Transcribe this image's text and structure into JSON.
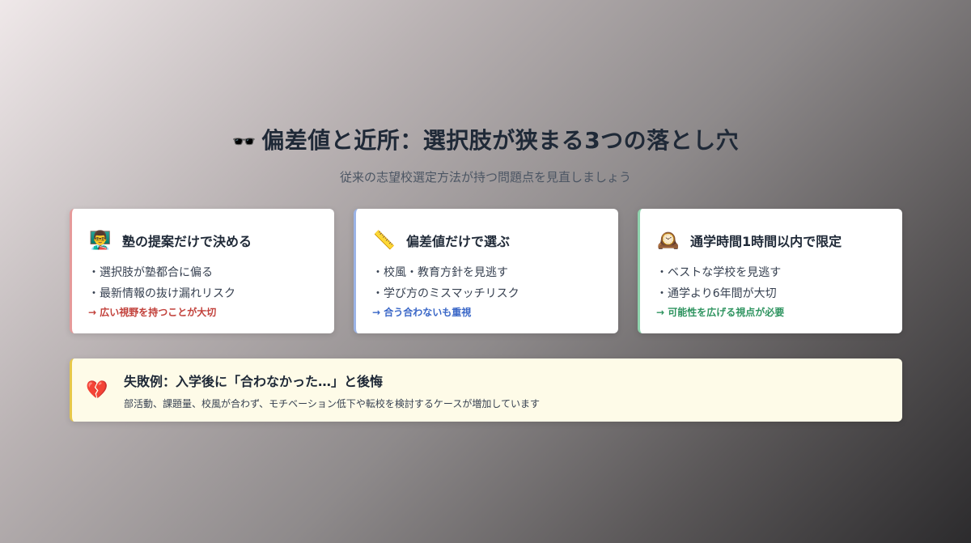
{
  "header": {
    "icon": "🕶️",
    "title": "偏差値と近所：選択肢が狭まる3つの落とし穴",
    "subtitle": "従来の志望校選定方法が持つ問題点を見直しましょう"
  },
  "cards": [
    {
      "icon": "👨‍🏫",
      "title": "塾の提案だけで決める",
      "points": [
        "・選択肢が塾都合に偏る",
        "・最新情報の抜け漏れリスク"
      ],
      "note": "→ 広い視野を持つことが大切",
      "accent": "#c2413b"
    },
    {
      "icon": "📏",
      "title": "偏差値だけで選ぶ",
      "points": [
        "・校風・教育方針を見逃す",
        "・学び方のミスマッチリスク"
      ],
      "note": "→ 合う合わないも重視",
      "accent": "#3a67c7"
    },
    {
      "icon": "🕰️",
      "title": "通学時間1時間以内で限定",
      "points": [
        "・ベストな学校を見逃す",
        "・通学より6年間が大切"
      ],
      "note": "→ 可能性を広げる視点が必要",
      "accent": "#2f9460"
    }
  ],
  "banner": {
    "icon": "💔",
    "title": "失敗例：入学後に「合わなかった…」と後悔",
    "text": "部活動、課題量、校風が合わず、モチベーション低下や転校を検討するケースが増加しています"
  }
}
